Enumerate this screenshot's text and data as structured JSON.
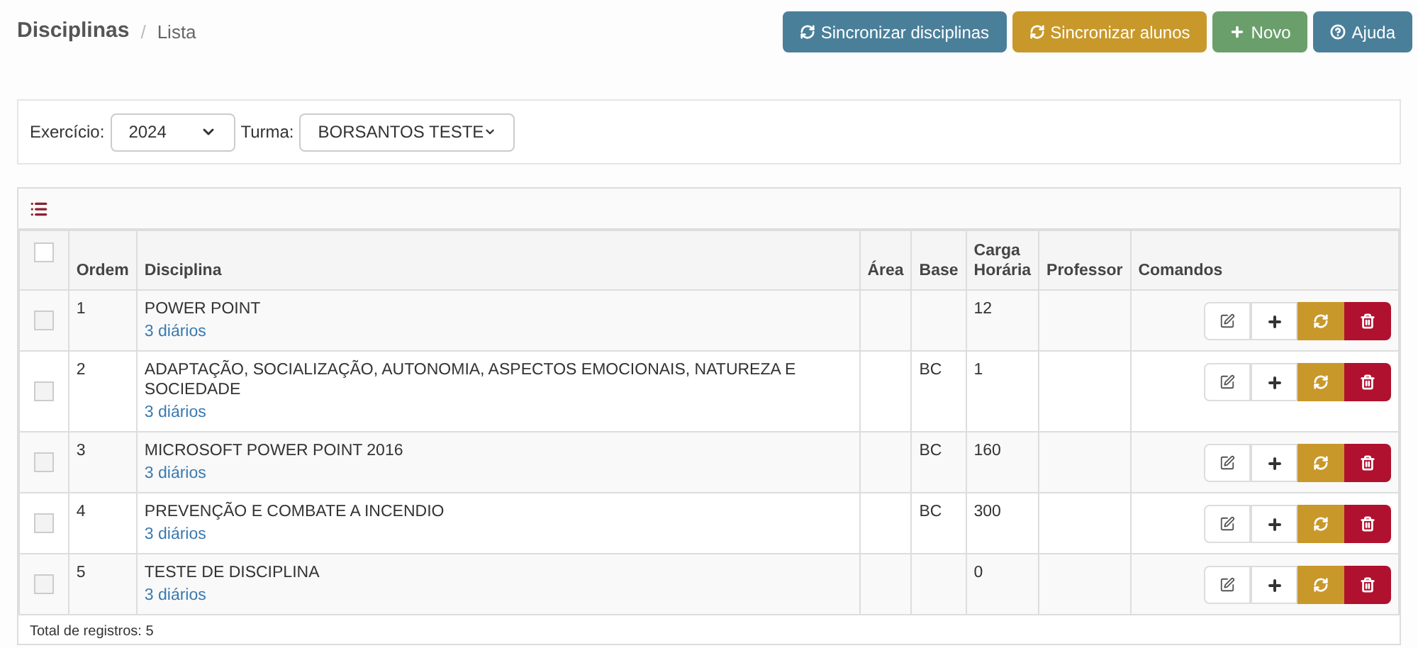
{
  "breadcrumb": {
    "title": "Disciplinas",
    "separator": "/",
    "current": "Lista"
  },
  "actions": [
    {
      "kind": "sync",
      "label": "Sincronizar disciplinas",
      "color": "#4a7f9a"
    },
    {
      "kind": "sync",
      "label": "Sincronizar alunos",
      "color": "#c8982a"
    },
    {
      "kind": "plus",
      "label": "Novo",
      "color": "#6a9f6c"
    },
    {
      "kind": "help",
      "label": "Ajuda",
      "color": "#4a7f9a"
    }
  ],
  "filters": [
    {
      "label": "Exercício:",
      "value": "2024"
    },
    {
      "label": "Turma:",
      "value": "BORSANTOS TESTE"
    }
  ],
  "table": {
    "all_checked": false,
    "columns": [
      "Ordem",
      "Disciplina",
      "Área",
      "Base",
      "Carga Horária",
      "Professor",
      "Comandos"
    ],
    "rows": [
      {
        "checked": false,
        "ordem": "1",
        "disciplina": "POWER POINT",
        "link": "3 diários",
        "area": "",
        "base": "",
        "carga": "12",
        "professor": ""
      },
      {
        "checked": false,
        "ordem": "2",
        "disciplina": "ADAPTAÇÃO, SOCIALIZAÇÃO, AUTONOMIA, ASPECTOS EMOCIONAIS, NATUREZA E SOCIEDADE",
        "link": "3 diários",
        "area": "",
        "base": "BC",
        "carga": "1",
        "professor": ""
      },
      {
        "checked": false,
        "ordem": "3",
        "disciplina": "MICROSOFT POWER POINT 2016",
        "link": "3 diários",
        "area": "",
        "base": "BC",
        "carga": "160",
        "professor": ""
      },
      {
        "checked": false,
        "ordem": "4",
        "disciplina": "PREVENÇÃO E COMBATE A INCENDIO",
        "link": "3 diários",
        "area": "",
        "base": "BC",
        "carga": "300",
        "professor": ""
      },
      {
        "checked": false,
        "ordem": "5",
        "disciplina": "TESTE DE DISCIPLINA",
        "link": "3 diários",
        "area": "",
        "base": "",
        "carga": "0",
        "professor": ""
      }
    ]
  },
  "footer": "Total de registros: 5"
}
